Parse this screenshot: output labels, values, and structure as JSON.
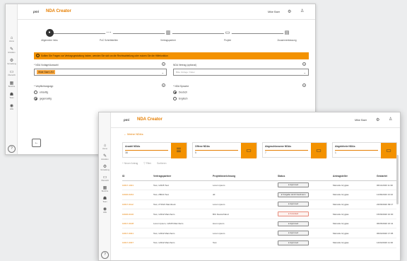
{
  "back": {
    "logo": "pmi",
    "app_name": "NDA Creator",
    "user": "Mike Baer",
    "rail": [
      {
        "icon": "⌂",
        "label": "Home"
      },
      {
        "icon": "✎",
        "label": "Erstellen"
      },
      {
        "icon": "⚙",
        "label": "Verwaltung"
      },
      {
        "icon": "▭",
        "label": "Übersicht"
      },
      {
        "icon": "▦",
        "label": "Berichte"
      },
      {
        "icon": "☗",
        "label": "Team"
      },
      {
        "icon": "◉",
        "label": "Hilfe"
      }
    ],
    "steps": [
      {
        "label": "Allgemeine Infos",
        "icon": "●"
      },
      {
        "label": "PoC Schnittstellen",
        "icon": "⋯"
      },
      {
        "label": "Vertragspartner",
        "icon": "▥"
      },
      {
        "label": "Projekt",
        "icon": "▭"
      },
      {
        "label": "Zusammenfassung",
        "icon": "▤"
      }
    ],
    "banner": "Sollten Sie Fragen zur Vertragsgestaltung haben, wenden Sie sich an die Rechtsabteilung oder nutzen Sie die Hilfefunktion",
    "field1_label": "* NDA Vorlage/Auswahl",
    "field1_value": "Wide Start LRJ",
    "field2_label": "NDA Vertrag (optional)",
    "field2_placeholder": "Bitte Vorlage / Datei",
    "group1_label": "* Verpflichtungstyp",
    "group1_options": [
      "einseitig",
      "gegenseitig"
    ],
    "group2_label": "* NDA Sprache",
    "group2_options": [
      "Deutsch",
      "Englisch"
    ]
  },
  "front": {
    "logo": "pmi",
    "app_name": "NDA Creator",
    "user": "Mike Baer",
    "breadcrumb": "← Meine NDAs",
    "rail": [
      {
        "icon": "⌂",
        "label": "Home"
      },
      {
        "icon": "✎",
        "label": "Erstellen"
      },
      {
        "icon": "⚙",
        "label": "Verwaltung"
      },
      {
        "icon": "▭",
        "label": "Übersicht"
      },
      {
        "icon": "▦",
        "label": "Berichte"
      },
      {
        "icon": "☗",
        "label": "Team"
      },
      {
        "icon": "◉",
        "label": "Hilfe"
      }
    ],
    "cards": [
      {
        "title": "Anzahl NDAs",
        "value": "38",
        "icon": "☰"
      },
      {
        "title": "Offene NDAs",
        "value": "5",
        "icon": "▭"
      },
      {
        "title": "Abgeschlossene NDAs",
        "value": "7",
        "icon": "▭"
      },
      {
        "title": "Abgelehnte NDAs",
        "value": "1",
        "icon": "▭"
      }
    ],
    "toolbar": [
      "+ Neuer Antrag",
      "▽ Filter",
      "Sortieren"
    ],
    "columns": [
      "ID",
      "Vertragspartner",
      "Projektbezeichnung",
      "Status",
      "Antragsteller",
      "Gestartet"
    ],
    "rows": [
      {
        "id": "10017-1021",
        "partner": "Test, 12345 Test",
        "project": "Lorem ipsum",
        "status": "Approved",
        "status_type": "ok",
        "applicant": "Marcelle Gryglas",
        "date": "06/11/2020 11:30"
      },
      {
        "id": "10020-0234",
        "partner": "Test, 28044 Test",
        "project": "dd",
        "status": "Freigabe durch Kaufmann",
        "status_type": "ok",
        "applicant": "Marcelle Gryglas",
        "date": "11/09/2020 13:10"
      },
      {
        "id": "10017-0112",
        "partner": "Test, 271621 Mannheim",
        "project": "Lorem ipsum",
        "status": "Approved",
        "status_type": "ok",
        "applicant": "Marcelle Gryglas",
        "date": "23/06/2020 09:17"
      },
      {
        "id": "10020-0130",
        "partner": "Test, 12342 Mannheim",
        "project": "BIC Deutschland",
        "status": "Canceled",
        "status_type": "warn",
        "applicant": "Marcelle Gryglas",
        "date": "15/06/2020 10:30"
      },
      {
        "id": "10017-0108",
        "partner": "Lorem Ipsum, 12345 Mannheim",
        "project": "lorem ipsum",
        "status": "Approved",
        "status_type": "ok",
        "applicant": "Marcelle Gryglas",
        "date": "06/05/2020 16:41"
      },
      {
        "id": "10017-0041",
        "partner": "Test, 12342 Mannheim",
        "project": "Lorem ipsum",
        "status": "Approved",
        "status_type": "ok",
        "applicant": "Marcelle Gryglas",
        "date": "06/04/2020 17:05"
      },
      {
        "id": "10017-0037",
        "partner": "Test, 12342 Mannheim",
        "project": "Test",
        "status": "Approved",
        "status_type": "ok",
        "applicant": "Marcelle Gryglas",
        "date": "14/04/2020 11:30"
      }
    ]
  }
}
